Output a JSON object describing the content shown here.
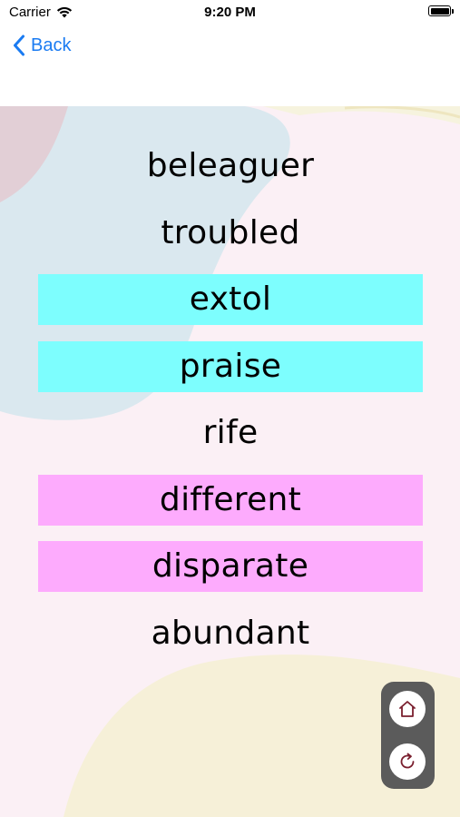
{
  "status_bar": {
    "carrier": "Carrier",
    "time": "9:20 PM",
    "icons": [
      "wifi-icon",
      "battery-icon"
    ]
  },
  "nav": {
    "back_label": "Back",
    "back_icon": "chevron-left-icon",
    "accent_color": "#1a7bf2"
  },
  "words": [
    {
      "text": "beleaguer",
      "highlight": "none"
    },
    {
      "text": "troubled",
      "highlight": "none"
    },
    {
      "text": "extol",
      "highlight": "cyan"
    },
    {
      "text": "praise",
      "highlight": "cyan"
    },
    {
      "text": "rife",
      "highlight": "none"
    },
    {
      "text": "different",
      "highlight": "pink"
    },
    {
      "text": "disparate",
      "highlight": "pink"
    },
    {
      "text": "abundant",
      "highlight": "none"
    }
  ],
  "highlight_colors": {
    "cyan": "#7dfefe",
    "pink": "#fdabfd"
  },
  "floating_controls": {
    "buttons": [
      "home-icon",
      "restart-icon"
    ],
    "icon_color": "#7a1f2e"
  }
}
